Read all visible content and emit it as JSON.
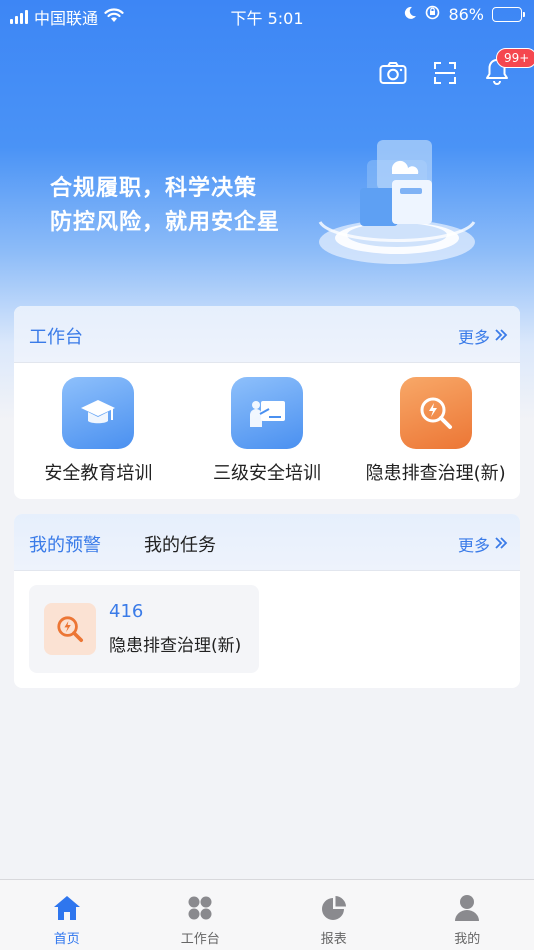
{
  "status_bar": {
    "carrier": "中国联通",
    "time": "下午 5:01",
    "battery": "86%",
    "battery_level": 0.86
  },
  "header": {
    "camera_icon": "camera-icon",
    "scan_icon": "scan-icon",
    "bell_icon": "bell-icon",
    "notification_badge": "99+"
  },
  "hero": {
    "slogan_line1": "合规履职，科学决策",
    "slogan_line2": "防控风险，就用安企星"
  },
  "workbench": {
    "title": "工作台",
    "more": "更多",
    "apps": [
      {
        "label": "安全教育培训",
        "icon": "graduation-cap-icon",
        "color": "#4a90f0"
      },
      {
        "label": "三级安全培训",
        "icon": "teacher-board-icon",
        "color": "#4a90f0"
      },
      {
        "label": "隐患排查治理(新)",
        "icon": "hazard-search-icon",
        "color": "#ec7635"
      }
    ]
  },
  "tasks_card": {
    "tab_alerts": "我的预警",
    "tab_tasks": "我的任务",
    "more": "更多",
    "items": [
      {
        "count": "416",
        "name": "隐患排查治理(新)",
        "icon": "hazard-search-icon"
      }
    ]
  },
  "tabbar": {
    "items": [
      {
        "label": "首页",
        "icon": "home-icon",
        "active": true
      },
      {
        "label": "工作台",
        "icon": "grid-icon",
        "active": false
      },
      {
        "label": "报表",
        "icon": "pie-chart-icon",
        "active": false
      },
      {
        "label": "我的",
        "icon": "user-icon",
        "active": false
      }
    ]
  },
  "colors": {
    "primary": "#3a7be8",
    "accent_orange": "#ec7635",
    "badge_red": "#f5474f"
  }
}
